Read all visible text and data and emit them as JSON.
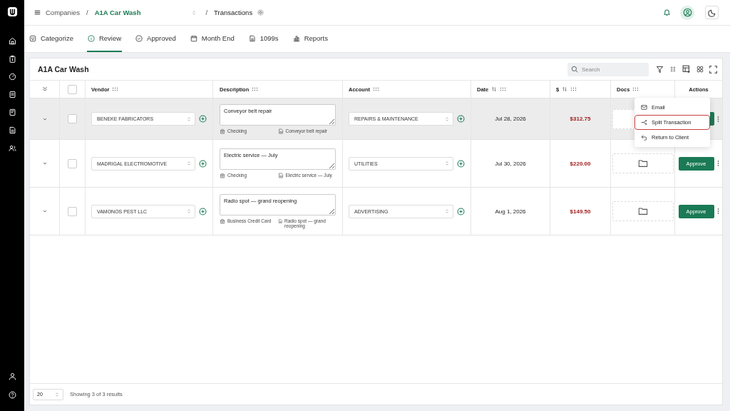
{
  "breadcrumb": {
    "root": "Companies",
    "separators": [
      "/",
      "/"
    ],
    "company": "A1A Car Wash",
    "page": "Transactions"
  },
  "tabs": [
    {
      "label": "Categorize",
      "kind": "logo",
      "selected": false
    },
    {
      "label": "Review",
      "kind": "info",
      "selected": true
    },
    {
      "label": "Approved",
      "kind": "check",
      "selected": false
    },
    {
      "label": "Month End",
      "kind": "calendar",
      "selected": false
    },
    {
      "label": "1099s",
      "kind": "file",
      "selected": false
    },
    {
      "label": "Reports",
      "kind": "chart",
      "selected": false
    }
  ],
  "select_all": {
    "checked": false
  },
  "card": {
    "title": "A1A Car Wash",
    "search": {
      "placeholder": "Search"
    }
  },
  "columns": [
    {
      "label": "Vendor",
      "sortable": false
    },
    {
      "label": "Description",
      "sortable": false
    },
    {
      "label": "Account",
      "sortable": false
    },
    {
      "label": "Date",
      "sortable": true
    },
    {
      "label": "$",
      "sortable": true
    },
    {
      "label": "Docs",
      "sortable": false
    },
    {
      "label": "Actions",
      "sortable": false
    }
  ],
  "rows": [
    {
      "vendor": "BENEKE FABRICATORS",
      "description": "Conveyor belt repair",
      "bank": "Checking",
      "memo": "Conveyor belt repair",
      "account": "REPAIRS & MAINTENANCE",
      "date": "Jul 28, 2026",
      "amount": "$312.75",
      "checked": false,
      "menu_open": true
    },
    {
      "vendor": "MADRIGAL ELECTROMOTIVE",
      "description": "Electric service — July",
      "bank": "Checking",
      "memo": "Electric service — July",
      "account": "UTILITIES",
      "date": "Jul 30, 2026",
      "amount": "$220.00",
      "checked": false,
      "menu_open": false,
      "approve": "Approve"
    },
    {
      "vendor": "VAMONOS PEST LLC",
      "description": "Radio spot — grand reopening",
      "bank": "Business Credit Card",
      "memo": "Radio spot — grand reopening",
      "account": "ADVERTISING",
      "date": "Aug 1, 2026",
      "amount": "$149.50",
      "checked": false,
      "menu_open": false,
      "approve": "Approve"
    }
  ],
  "menu": [
    {
      "label": "Email",
      "kind": "mail",
      "selected": false
    },
    {
      "label": "Split Transaction",
      "kind": "split",
      "selected": true
    },
    {
      "label": "Return to Client",
      "kind": "return",
      "selected": false
    }
  ],
  "footer": {
    "page_size": "20",
    "summary": "Showing 3 of 3 results"
  }
}
